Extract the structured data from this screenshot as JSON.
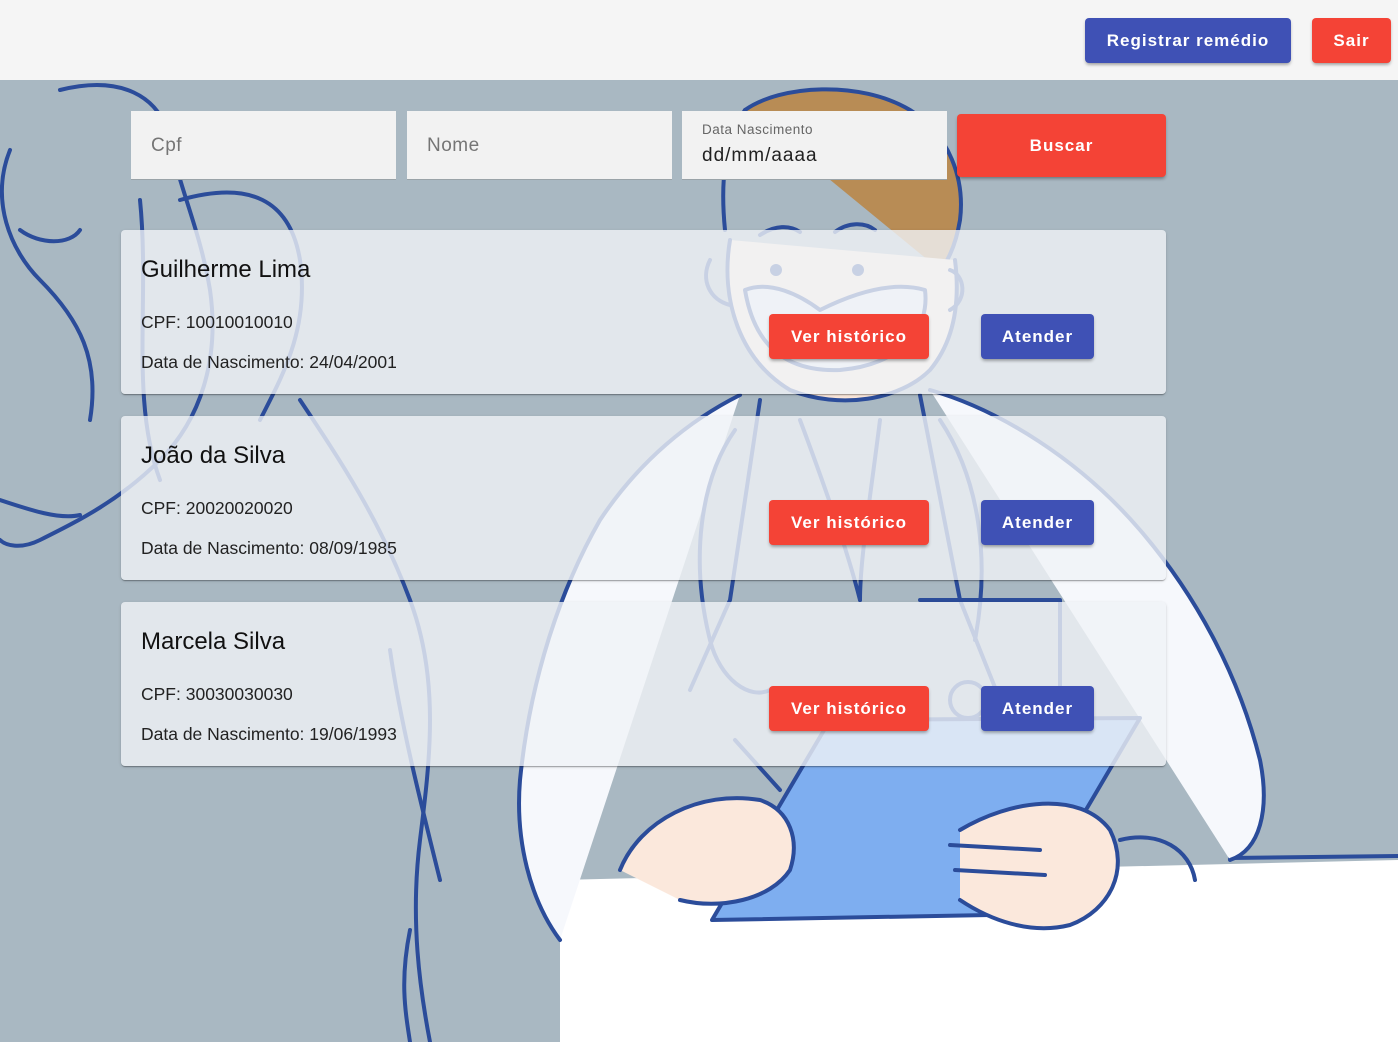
{
  "header": {
    "register_medicine_label": "Registrar remédio",
    "logout_label": "Sair"
  },
  "search": {
    "cpf_placeholder": "Cpf",
    "name_placeholder": "Nome",
    "birthdate_label": "Data Nascimento",
    "birthdate_value": "dd/mm/aaaa",
    "search_button_label": "Buscar"
  },
  "patients": [
    {
      "name": "Guilherme Lima",
      "cpf": "CPF: 10010010010",
      "birthdate": "Data de Nascimento: 24/04/2001",
      "history_label": "Ver histórico",
      "attend_label": "Atender"
    },
    {
      "name": "João da Silva",
      "cpf": "CPF: 20020020020",
      "birthdate": "Data de Nascimento: 08/09/1985",
      "history_label": "Ver histórico",
      "attend_label": "Atender"
    },
    {
      "name": "Marcela Silva",
      "cpf": "CPF: 30030030030",
      "birthdate": "Data de Nascimento: 19/06/1993",
      "history_label": "Ver histórico",
      "attend_label": "Atender"
    }
  ],
  "colors": {
    "primary": "#3f51b5",
    "warn": "#f44336",
    "background": "#a9b8c2",
    "illustration_stroke": "#2b4c9a"
  }
}
